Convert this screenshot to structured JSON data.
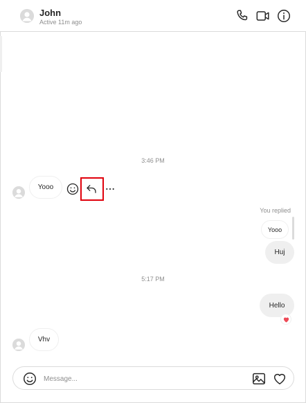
{
  "header": {
    "name": "John",
    "status": "Active 11m ago"
  },
  "thread": {
    "timestamp_1": "3:46 PM",
    "timestamp_2": "5:17 PM",
    "messages": [
      {
        "direction": "incoming",
        "text": "Yooo"
      },
      {
        "direction": "outgoing",
        "reply_label": "You replied",
        "quoted_text": "Yooo",
        "text": "Huj"
      },
      {
        "direction": "outgoing",
        "text": "Hello",
        "reaction": "heart"
      },
      {
        "direction": "incoming",
        "text": "Vhv"
      }
    ]
  },
  "composer": {
    "placeholder": "Message..."
  },
  "icons": {
    "header": [
      "phone-icon",
      "video-camera-icon",
      "info-icon"
    ],
    "message_actions": [
      "emoji-reaction-icon",
      "reply-icon",
      "more-options-icon"
    ],
    "composer": [
      "emoji-icon",
      "image-icon",
      "heart-icon"
    ]
  },
  "colors": {
    "highlight": "#e0000b",
    "reaction_heart": "#ed4956",
    "outgoing_bubble": "#efefef"
  }
}
